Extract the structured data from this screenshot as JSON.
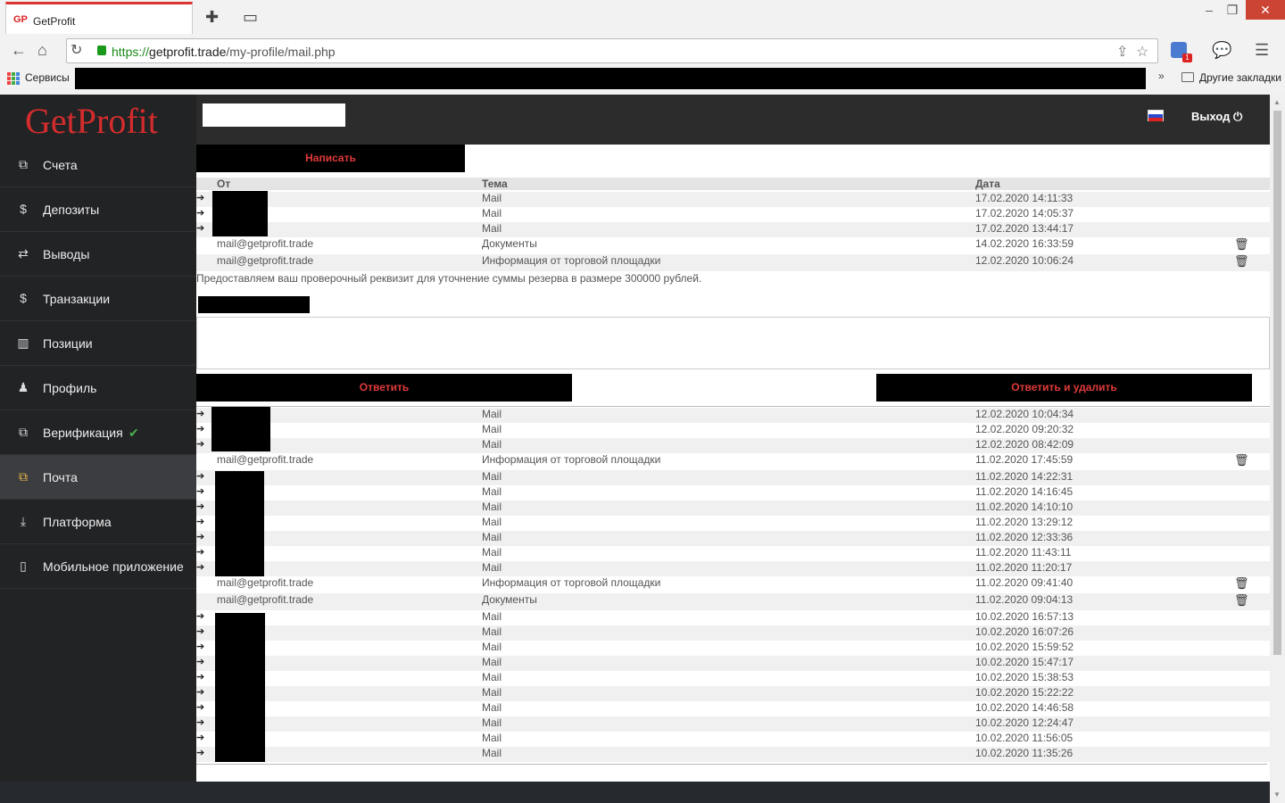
{
  "browser": {
    "tab_title": "GetProfit",
    "tab_favicon": "GP",
    "url_scheme": "https://",
    "url_host": "getprofit.trade",
    "url_path": "/my-profile/mail.php",
    "bookmarks_apps": "Сервисы",
    "bookmarks_more": "»",
    "bookmarks_other": "Другие закладки",
    "extension_badge": "1"
  },
  "sidebar": {
    "logo": "GetProfit",
    "items": [
      {
        "label": "Счета",
        "icon": "accounts-icon"
      },
      {
        "label": "Депозиты",
        "icon": "dollar-icon"
      },
      {
        "label": "Выводы",
        "icon": "transfer-icon"
      },
      {
        "label": "Транзакции",
        "icon": "dollar-icon"
      },
      {
        "label": "Позиции",
        "icon": "bar-chart-icon"
      },
      {
        "label": "Профиль",
        "icon": "person-icon"
      },
      {
        "label": "Верификация",
        "icon": "verify-icon"
      },
      {
        "label": "Почта",
        "icon": "mail-icon"
      },
      {
        "label": "Платформа",
        "icon": "download-icon"
      },
      {
        "label": "Мобильное приложение",
        "icon": "mobile-icon"
      }
    ],
    "active_index": 7
  },
  "topbar": {
    "logout_label": "Выход",
    "language": "ru"
  },
  "mail": {
    "compose_label": "Написать",
    "columns": {
      "from": "От",
      "subject": "Тема",
      "date": "Дата"
    },
    "reply_label": "Ответить",
    "reply_delete_label": "Ответить и удалить",
    "message_body": "Предоставляем ваш проверочный реквизит для уточнение суммы резерва в размере 300000 рублей.",
    "top_rows": [
      {
        "from": "",
        "subject": "Mail",
        "date": "17.02.2020 14:11:33",
        "incoming": true,
        "deletable": false
      },
      {
        "from": "",
        "subject": "Mail",
        "date": "17.02.2020 14:05:37",
        "incoming": true,
        "deletable": false
      },
      {
        "from": "",
        "subject": "Mail",
        "date": "17.02.2020 13:44:17",
        "incoming": true,
        "deletable": false
      },
      {
        "from": "mail@getprofit.trade",
        "subject": "Документы",
        "date": "14.02.2020 16:33:59",
        "incoming": false,
        "deletable": true
      },
      {
        "from": "mail@getprofit.trade",
        "subject": "Информация от торговой площадки",
        "date": "12.02.2020 10:06:24",
        "incoming": false,
        "deletable": true
      }
    ],
    "bottom_rows": [
      {
        "from": "",
        "subject": "Mail",
        "date": "12.02.2020 10:04:34",
        "incoming": true,
        "deletable": false
      },
      {
        "from": "",
        "subject": "Mail",
        "date": "12.02.2020 09:20:32",
        "incoming": true,
        "deletable": false
      },
      {
        "from": "",
        "subject": "Mail",
        "date": "12.02.2020 08:42:09",
        "incoming": true,
        "deletable": false
      },
      {
        "from": "mail@getprofit.trade",
        "subject": "Информация от торговой площадки",
        "date": "11.02.2020 17:45:59",
        "incoming": false,
        "deletable": true
      },
      {
        "from": "",
        "subject": "Mail",
        "date": "11.02.2020 14:22:31",
        "incoming": true,
        "deletable": false
      },
      {
        "from": "",
        "subject": "Mail",
        "date": "11.02.2020 14:16:45",
        "incoming": true,
        "deletable": false
      },
      {
        "from": "",
        "subject": "Mail",
        "date": "11.02.2020 14:10:10",
        "incoming": true,
        "deletable": false
      },
      {
        "from": "",
        "subject": "Mail",
        "date": "11.02.2020 13:29:12",
        "incoming": true,
        "deletable": false
      },
      {
        "from": "",
        "subject": "Mail",
        "date": "11.02.2020 12:33:36",
        "incoming": true,
        "deletable": false
      },
      {
        "from": "",
        "subject": "Mail",
        "date": "11.02.2020 11:43:11",
        "incoming": true,
        "deletable": false
      },
      {
        "from": "",
        "subject": "Mail",
        "date": "11.02.2020 11:20:17",
        "incoming": true,
        "deletable": false
      },
      {
        "from": "mail@getprofit.trade",
        "subject": "Информация от торговой площадки",
        "date": "11.02.2020 09:41:40",
        "incoming": false,
        "deletable": true
      },
      {
        "from": "mail@getprofit.trade",
        "subject": "Документы",
        "date": "11.02.2020 09:04:13",
        "incoming": false,
        "deletable": true
      },
      {
        "from": "",
        "subject": "Mail",
        "date": "10.02.2020 16:57:13",
        "incoming": true,
        "deletable": false
      },
      {
        "from": "",
        "subject": "Mail",
        "date": "10.02.2020 16:07:26",
        "incoming": true,
        "deletable": false
      },
      {
        "from": "",
        "subject": "Mail",
        "date": "10.02.2020 15:59:52",
        "incoming": true,
        "deletable": false
      },
      {
        "from": "",
        "subject": "Mail",
        "date": "10.02.2020 15:47:17",
        "incoming": true,
        "deletable": false
      },
      {
        "from": "",
        "subject": "Mail",
        "date": "10.02.2020 15:38:53",
        "incoming": true,
        "deletable": false
      },
      {
        "from": "",
        "subject": "Mail",
        "date": "10.02.2020 15:22:22",
        "incoming": true,
        "deletable": false
      },
      {
        "from": "",
        "subject": "Mail",
        "date": "10.02.2020 14:46:58",
        "incoming": true,
        "deletable": false
      },
      {
        "from": "",
        "subject": "Mail",
        "date": "10.02.2020 12:24:47",
        "incoming": true,
        "deletable": false
      },
      {
        "from": "",
        "subject": "Mail",
        "date": "10.02.2020 11:56:05",
        "incoming": true,
        "deletable": false
      },
      {
        "from": "",
        "subject": "Mail",
        "date": "10.02.2020 11:35:26",
        "incoming": true,
        "deletable": false
      }
    ]
  },
  "colors": {
    "brand_red": "#d42c2c",
    "sidebar_bg": "#222325",
    "active_icon": "#e8b84a",
    "verified_green": "#4caf50"
  }
}
